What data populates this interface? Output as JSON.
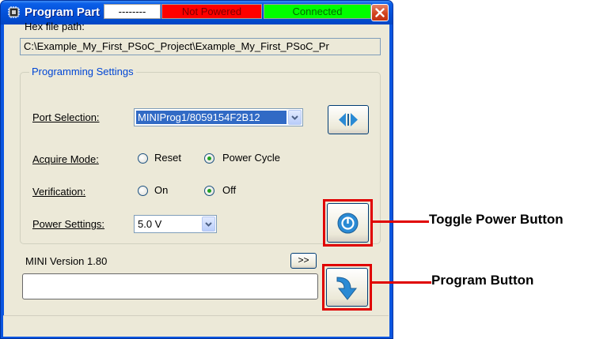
{
  "window": {
    "title": "Program Part"
  },
  "hex_file": {
    "label": "Hex file path:",
    "value": "C:\\Example_My_First_PSoC_Project\\Example_My_First_PSoC_Pr"
  },
  "programming_settings": {
    "group_title": "Programming Settings",
    "port_selection": {
      "label": "Port Selection:",
      "value": "MINIProg1/8059154F2B12"
    },
    "acquire_mode": {
      "label": "Acquire Mode:",
      "options": [
        "Reset",
        "Power Cycle"
      ],
      "selected": "Power Cycle"
    },
    "verification": {
      "label": "Verification:",
      "options": [
        "On",
        "Off"
      ],
      "selected": "Off"
    },
    "power_settings": {
      "label": "Power Settings:",
      "value": "5.0 V"
    }
  },
  "version": {
    "label": "MINI Version 1.80",
    "expand_label": ">>"
  },
  "status_bar": {
    "cells": [
      "--------",
      "Not Powered",
      "Connected"
    ]
  },
  "callouts": {
    "toggle_power": "Toggle Power Button",
    "program": "Program Button"
  },
  "icons": [
    "app-icon",
    "close-icon",
    "chevron-down-icon",
    "connect-arrows-icon",
    "power-icon",
    "program-arrow-icon"
  ],
  "colors": {
    "title_bar": "#0a5ee8",
    "dialog_bg": "#ece9d8",
    "selection": "#316ac5",
    "not_powered": "#ff0000",
    "connected": "#00ff00",
    "callout": "#e00000",
    "icon_blue": "#2a8ad4"
  }
}
